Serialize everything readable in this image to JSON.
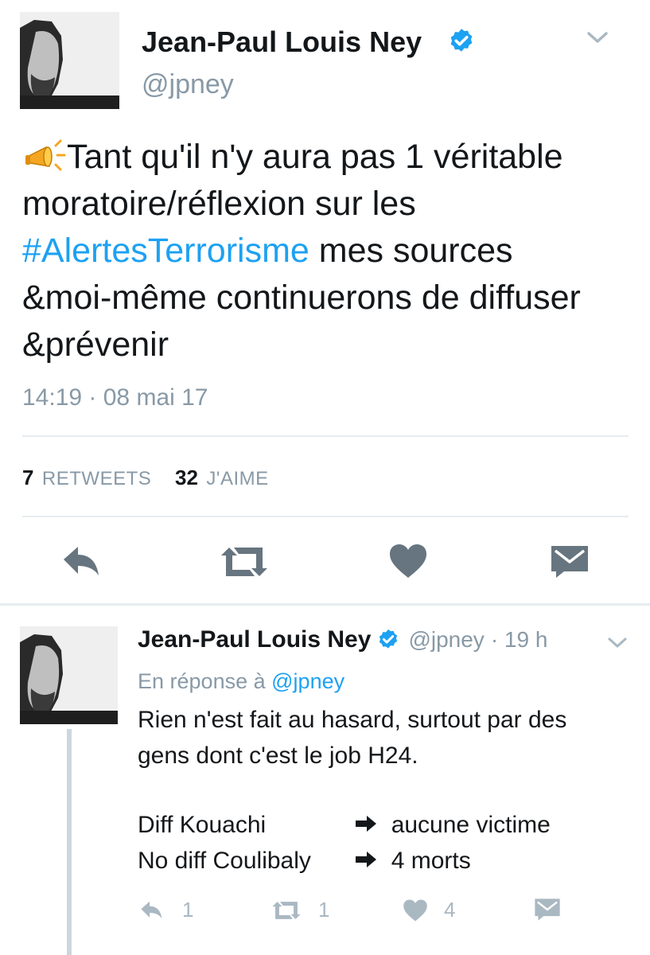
{
  "main_tweet": {
    "author_name": "Jean-Paul Louis Ney",
    "handle": "@jpney",
    "text_intro": "Tant qu'il n'y aura pas 1 véritable",
    "text_line2": "moratoire/réflexion sur les",
    "hashtag": "#AlertesTerrorisme",
    "text_after_hashtag": " mes sources",
    "text_line4": "&moi-même continuerons de diffuser",
    "text_line5": "&prévenir",
    "timestamp": "14:19 · 08 mai 17",
    "retweets_count": "7",
    "retweets_label": "RETWEETS",
    "likes_count": "32",
    "likes_label": "J'AIME",
    "accent_color": "#1da1f2",
    "icon_color": "#66757f"
  },
  "reply_tweet": {
    "author_name": "Jean-Paul Louis Ney",
    "handle": "@jpney",
    "time_ago": "· 19 h",
    "in_reply_label": "En réponse à",
    "in_reply_handle": "@jpney",
    "text_line1": "Rien n'est fait au hasard, surtout par des",
    "text_line2": "gens dont c'est le job H24.",
    "row1_left": "Diff Kouachi",
    "row1_right": "aucune victime",
    "row2_left": "No diff Coulibaly",
    "row2_right": "4 morts",
    "reply_count": "1",
    "retweet_count": "1",
    "like_count": "4"
  },
  "icons": {
    "verified": "verified-badge-icon",
    "dropdown": "chevron-down-icon",
    "reply": "reply-icon",
    "retweet": "retweet-icon",
    "like": "heart-icon",
    "dm": "envelope-icon",
    "emoji": "megaphone-icon",
    "arrow": "right-arrow-icon"
  }
}
